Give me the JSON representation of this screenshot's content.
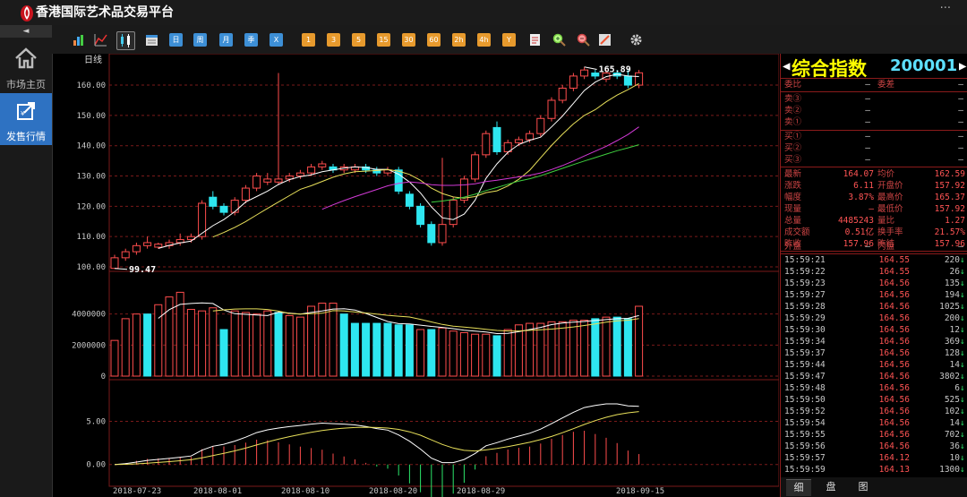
{
  "app": {
    "title": "香港国际艺术品交易平台",
    "more": "···"
  },
  "leftnav": {
    "collapse": "◄",
    "items": [
      {
        "label": "市场主页",
        "icon": "home-icon"
      },
      {
        "label": "发售行情",
        "icon": "external-link-icon",
        "active": true
      }
    ]
  },
  "toolbar": {
    "chart_icons": [
      "bar-chart-icon",
      "line-chart-icon",
      "candlestick-icon",
      "calendar-icon"
    ],
    "periods": [
      {
        "label": "日",
        "style": "blue"
      },
      {
        "label": "周",
        "style": "blue"
      },
      {
        "label": "月",
        "style": "blue"
      },
      {
        "label": "季",
        "style": "blue"
      },
      {
        "label": "X",
        "style": "blue"
      },
      {
        "label": "1",
        "style": "orange"
      },
      {
        "label": "3",
        "style": "orange"
      },
      {
        "label": "5",
        "style": "orange"
      },
      {
        "label": "15",
        "style": "orange"
      },
      {
        "label": "30",
        "style": "orange"
      },
      {
        "label": "60",
        "style": "orange"
      },
      {
        "label": "2h",
        "style": "orange"
      },
      {
        "label": "4h",
        "style": "orange"
      },
      {
        "label": "Y",
        "style": "orange"
      }
    ],
    "tool_icons": [
      "notepad-icon",
      "zoom-in-icon",
      "zoom-out-icon",
      "draw-icon",
      "gear-icon"
    ]
  },
  "chart_data": {
    "type": "candlestick",
    "period_label": "日线",
    "price_axis": {
      "ticks": [
        "160.00",
        "150.00",
        "140.00",
        "130.00",
        "120.00",
        "110.00",
        "100.00"
      ],
      "ylim": [
        100,
        168
      ]
    },
    "volume_axis": {
      "ticks": [
        "4000000",
        "2000000",
        "0"
      ],
      "ylim": [
        0,
        6000000
      ]
    },
    "indicator_axis": {
      "ticks": [
        "5.00",
        "0.00"
      ],
      "ylim": [
        -2,
        9
      ]
    },
    "x_labels": [
      "2018-07-23",
      "2018-08-01",
      "2018-08-10",
      "2018-08-20",
      "2018-08-29",
      "2018-09-15"
    ],
    "annotations": {
      "high": "165.89",
      "low": "99.47"
    },
    "candles": [
      [
        99.5,
        103,
        104,
        99.47
      ],
      [
        103,
        105,
        106,
        102
      ],
      [
        105,
        107,
        108,
        104
      ],
      [
        107,
        108,
        110,
        106
      ],
      [
        106.5,
        107.5,
        108,
        106
      ],
      [
        107,
        108,
        109,
        106
      ],
      [
        108,
        109,
        111,
        107
      ],
      [
        109,
        110,
        111,
        108
      ],
      [
        110,
        121,
        122,
        109
      ],
      [
        123,
        120,
        125,
        119
      ],
      [
        120,
        118,
        121,
        117
      ],
      [
        118,
        122,
        123,
        117
      ],
      [
        122,
        126,
        127,
        121
      ],
      [
        126,
        130,
        131,
        125
      ],
      [
        128,
        129,
        131,
        127
      ],
      [
        128,
        129,
        164,
        127
      ],
      [
        129,
        130,
        131,
        128
      ],
      [
        130,
        131,
        132,
        129
      ],
      [
        131,
        133,
        134,
        130
      ],
      [
        133,
        134,
        135,
        132
      ],
      [
        133,
        132,
        134,
        131
      ],
      [
        132,
        133,
        134,
        131
      ],
      [
        132,
        133,
        134,
        131
      ],
      [
        133,
        132,
        134,
        131
      ],
      [
        132,
        131,
        133,
        130
      ],
      [
        131,
        132,
        133,
        130
      ],
      [
        132,
        125,
        133,
        124
      ],
      [
        124,
        120,
        125,
        119
      ],
      [
        120,
        114,
        121,
        113
      ],
      [
        114,
        108,
        115,
        107
      ],
      [
        108,
        114,
        136,
        107
      ],
      [
        114,
        122,
        123,
        113
      ],
      [
        122,
        129,
        130,
        121
      ],
      [
        129,
        137,
        138,
        128
      ],
      [
        137,
        144,
        145,
        136
      ],
      [
        146,
        138,
        148,
        137
      ],
      [
        138,
        141,
        142,
        137
      ],
      [
        141,
        142,
        143,
        140
      ],
      [
        142,
        144,
        145,
        141
      ],
      [
        144,
        149,
        150,
        143
      ],
      [
        149,
        155,
        156,
        148
      ],
      [
        155,
        159,
        160,
        154
      ],
      [
        159,
        163,
        164,
        158
      ],
      [
        163,
        165,
        166,
        162
      ],
      [
        164,
        163,
        165,
        162
      ],
      [
        162,
        164,
        165,
        161
      ],
      [
        164,
        163,
        165,
        162
      ],
      [
        163,
        160,
        165,
        159
      ],
      [
        160,
        164.07,
        165,
        159
      ]
    ],
    "volumes": [
      2300000,
      3700000,
      4000000,
      4000000,
      4600000,
      5100000,
      5400000,
      4300000,
      4200000,
      4400000,
      3000000,
      4200000,
      4100000,
      4000000,
      4200000,
      4100000,
      3900000,
      3800000,
      4500000,
      4700000,
      4700000,
      4000000,
      3400000,
      3400000,
      3400000,
      3400000,
      3300000,
      3300000,
      3000000,
      3000000,
      3100000,
      2900000,
      2800000,
      2700000,
      2700000,
      2600000,
      3000000,
      3300000,
      3400000,
      3400000,
      3500000,
      3500000,
      3600000,
      3600000,
      3700000,
      3800000,
      3800000,
      3700000,
      4500000
    ],
    "volume_up": [
      true,
      true,
      true,
      false,
      true,
      true,
      true,
      true,
      true,
      true,
      false,
      true,
      true,
      true,
      true,
      false,
      true,
      true,
      true,
      true,
      true,
      false,
      false,
      false,
      false,
      false,
      false,
      false,
      true,
      false,
      true,
      true,
      true,
      true,
      true,
      false,
      true,
      true,
      true,
      true,
      true,
      true,
      true,
      true,
      false,
      true,
      false,
      false,
      true
    ]
  },
  "quote": {
    "name": "综合指数",
    "code": "200001",
    "weibi_label": "委比",
    "weibi": "—",
    "weicha_label": "委差",
    "weicha": "—",
    "asks": [
      {
        "label": "卖③",
        "price": "—",
        "vol": "—"
      },
      {
        "label": "卖②",
        "price": "—",
        "vol": "—"
      },
      {
        "label": "卖①",
        "price": "—",
        "vol": "—"
      }
    ],
    "bids": [
      {
        "label": "买①",
        "price": "—",
        "vol": "—"
      },
      {
        "label": "买②",
        "price": "—",
        "vol": "—"
      },
      {
        "label": "买③",
        "price": "—",
        "vol": "—"
      }
    ],
    "stats": [
      [
        {
          "l": "最新",
          "v": "164.07"
        },
        {
          "l": "均价",
          "v": "162.59"
        }
      ],
      [
        {
          "l": "涨跌",
          "v": "6.11"
        },
        {
          "l": "开盘价",
          "v": "157.92"
        }
      ],
      [
        {
          "l": "幅度",
          "v": "3.87%"
        },
        {
          "l": "最高价",
          "v": "165.37"
        }
      ],
      [
        {
          "l": "现量",
          "v": "—"
        },
        {
          "l": "最低价",
          "v": "157.92"
        }
      ],
      [
        {
          "l": "总量",
          "v": "4485243"
        },
        {
          "l": "量比",
          "v": "1.27"
        }
      ],
      [
        {
          "l": "成交额",
          "v": "0.51亿"
        },
        {
          "l": "换手率",
          "v": "21.57%"
        }
      ],
      [
        {
          "l": "昨收",
          "v": "157.96"
        },
        {
          "l": "昨结",
          "v": "157.96"
        }
      ]
    ],
    "outer_label": "外盘",
    "outer": "—",
    "inner_label": "内盘",
    "inner": "—",
    "ticks": [
      {
        "t": "15:59:21",
        "p": "164.55",
        "v": "220"
      },
      {
        "t": "15:59:22",
        "p": "164.55",
        "v": "26"
      },
      {
        "t": "15:59:23",
        "p": "164.56",
        "v": "135"
      },
      {
        "t": "15:59:27",
        "p": "164.56",
        "v": "194"
      },
      {
        "t": "15:59:28",
        "p": "164.56",
        "v": "1025"
      },
      {
        "t": "15:59:29",
        "p": "164.56",
        "v": "200"
      },
      {
        "t": "15:59:30",
        "p": "164.56",
        "v": "12"
      },
      {
        "t": "15:59:34",
        "p": "164.56",
        "v": "369"
      },
      {
        "t": "15:59:37",
        "p": "164.56",
        "v": "128"
      },
      {
        "t": "15:59:44",
        "p": "164.56",
        "v": "14"
      },
      {
        "t": "15:59:47",
        "p": "164.56",
        "v": "3802"
      },
      {
        "t": "15:59:48",
        "p": "164.56",
        "v": "6"
      },
      {
        "t": "15:59:50",
        "p": "164.56",
        "v": "525"
      },
      {
        "t": "15:59:52",
        "p": "164.56",
        "v": "102"
      },
      {
        "t": "15:59:54",
        "p": "164.56",
        "v": "14"
      },
      {
        "t": "15:59:55",
        "p": "164.56",
        "v": "702"
      },
      {
        "t": "15:59:56",
        "p": "164.56",
        "v": "36"
      },
      {
        "t": "15:59:57",
        "p": "164.12",
        "v": "10"
      },
      {
        "t": "15:59:59",
        "p": "164.13",
        "v": "1300"
      }
    ],
    "tick_arrow": "↓",
    "tabs": [
      {
        "label": "细",
        "active": true
      },
      {
        "label": "盘"
      },
      {
        "label": "图"
      }
    ]
  },
  "colors": {
    "up": "#ff4d4d",
    "down": "#2ee6f0",
    "grid": "#7a1a1a",
    "ma5": "#ffffff",
    "ma10": "#e8e05a",
    "ma20": "#d23ad6",
    "ma30": "#3ecf3e"
  }
}
